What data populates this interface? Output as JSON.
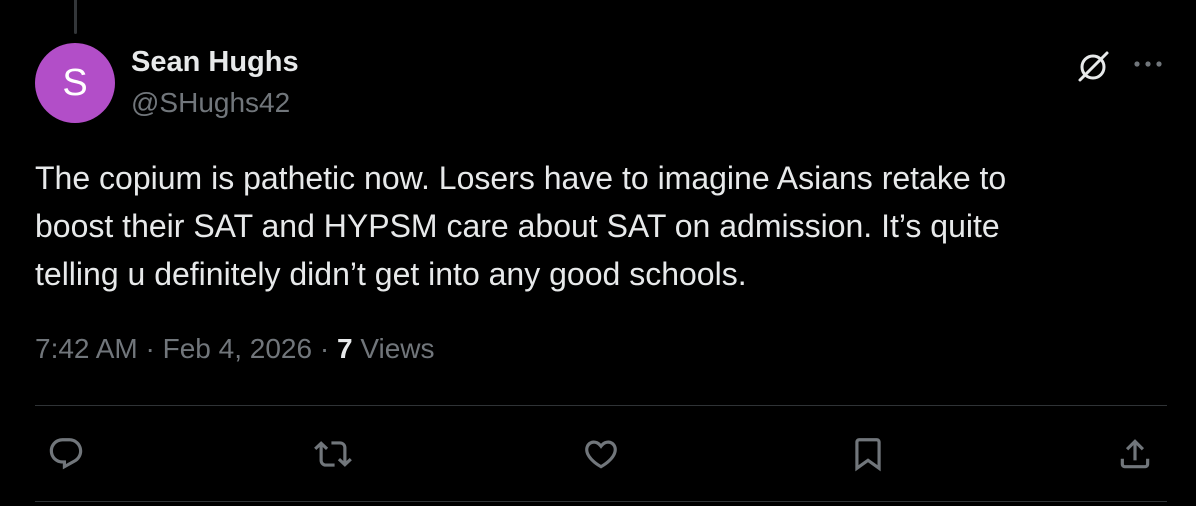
{
  "author": {
    "avatar_letter": "S",
    "avatar_color": "#b24ec8",
    "name": "Sean Hughs",
    "handle": "@SHughs42"
  },
  "tweet": {
    "text_lines": [
      "The copium is pathetic now. Losers have to imagine Asians retake to",
      "boost their SAT and HYPSM care about SAT on admission. It’s quite",
      "telling u definitely didn’t get into any good schools."
    ],
    "time": "7:42 AM",
    "date": "Feb 4, 2026",
    "separator": "·",
    "views_count": "7",
    "views_label": "Views"
  },
  "header_icons": [
    "grok-icon",
    "more-icon"
  ],
  "actions": [
    "reply-icon",
    "retweet-icon",
    "like-icon",
    "bookmark-icon",
    "share-icon"
  ],
  "colors": {
    "background": "#000000",
    "text_primary": "#e7e9ea",
    "text_secondary": "#71767b",
    "divider": "#2f3336"
  }
}
